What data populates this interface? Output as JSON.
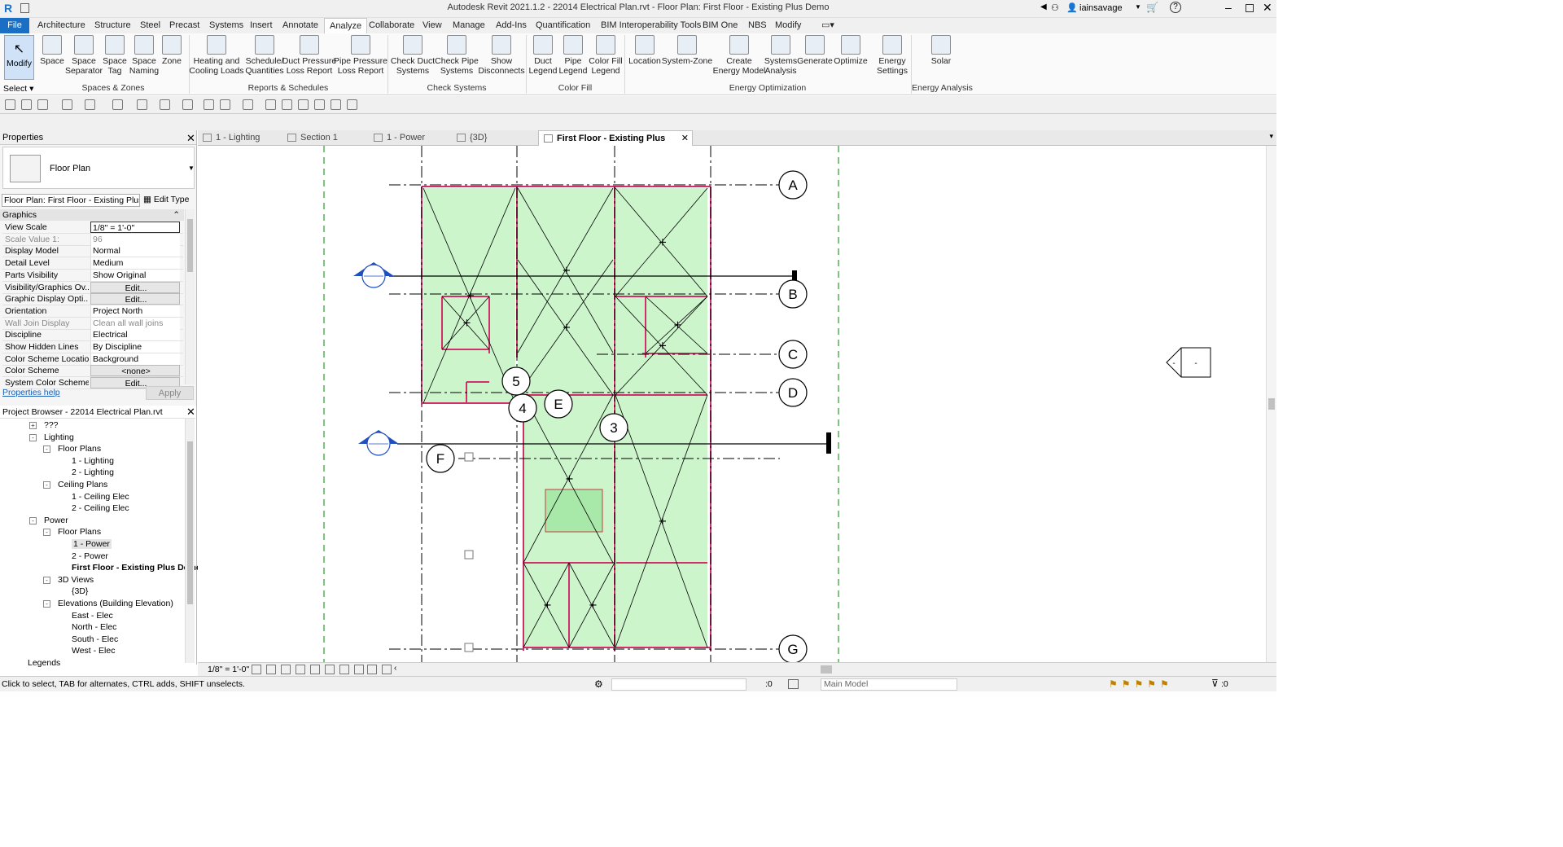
{
  "app": {
    "title": "Autodesk Revit 2021.1.2 - 22014 Electrical Plan.rvt - Floor Plan: First Floor - Existing Plus Demo",
    "user": "iainsavage",
    "help": "?"
  },
  "menu": {
    "tabs": [
      "File",
      "Architecture",
      "Structure",
      "Steel",
      "Precast",
      "Systems",
      "Insert",
      "Annotate",
      "Analyze",
      "Collaborate",
      "View",
      "Manage",
      "Add-Ins",
      "Quantification",
      "BIM Interoperability Tools",
      "BIM One",
      "NBS",
      "Modify"
    ],
    "active": "Analyze"
  },
  "ribbon": {
    "modify": "Modify",
    "select": "Select",
    "buttons": [
      {
        "l1": "Space",
        "l2": ""
      },
      {
        "l1": "Space",
        "l2": "Separator"
      },
      {
        "l1": "Space",
        "l2": "Tag"
      },
      {
        "l1": "Space",
        "l2": "Naming"
      },
      {
        "l1": "Zone",
        "l2": ""
      },
      {
        "l1": "Heating and",
        "l2": "Cooling Loads"
      },
      {
        "l1": "Schedule/",
        "l2": "Quantities"
      },
      {
        "l1": "Duct Pressure",
        "l2": "Loss Report"
      },
      {
        "l1": "Pipe Pressure",
        "l2": "Loss Report"
      },
      {
        "l1": "Check Duct",
        "l2": "Systems"
      },
      {
        "l1": "Check Pipe",
        "l2": "Systems"
      },
      {
        "l1": "Show",
        "l2": "Disconnects"
      },
      {
        "l1": "Duct",
        "l2": "Legend"
      },
      {
        "l1": "Pipe",
        "l2": "Legend"
      },
      {
        "l1": "Color Fill",
        "l2": "Legend"
      },
      {
        "l1": "Location",
        "l2": ""
      },
      {
        "l1": "System-Zone",
        "l2": ""
      },
      {
        "l1": "Create",
        "l2": "Energy Model"
      },
      {
        "l1": "Systems",
        "l2": "Analysis"
      },
      {
        "l1": "Generate",
        "l2": ""
      },
      {
        "l1": "Optimize",
        "l2": ""
      },
      {
        "l1": "Energy",
        "l2": "Settings"
      },
      {
        "l1": "Solar",
        "l2": ""
      }
    ],
    "groups": [
      "Spaces & Zones",
      "Reports & Schedules",
      "Check Systems",
      "Color Fill",
      "Energy Optimization",
      "Energy Analysis"
    ]
  },
  "properties": {
    "title": "Properties",
    "type_name": "Floor Plan",
    "instance": "Floor Plan: First Floor - Existing Plus",
    "edit_type": "Edit Type",
    "section": "Graphics",
    "rows": [
      {
        "k": "View Scale",
        "v": "1/8\" = 1'-0\""
      },
      {
        "k": "Scale Value    1:",
        "v": "96"
      },
      {
        "k": "Display Model",
        "v": "Normal"
      },
      {
        "k": "Detail Level",
        "v": "Medium"
      },
      {
        "k": "Parts Visibility",
        "v": "Show Original"
      },
      {
        "k": "Visibility/Graphics Ov...",
        "v": "Edit..."
      },
      {
        "k": "Graphic Display Opti...",
        "v": "Edit..."
      },
      {
        "k": "Orientation",
        "v": "Project North"
      },
      {
        "k": "Wall Join Display",
        "v": "Clean all wall joins"
      },
      {
        "k": "Discipline",
        "v": "Electrical"
      },
      {
        "k": "Show Hidden Lines",
        "v": "By Discipline"
      },
      {
        "k": "Color Scheme Location",
        "v": "Background"
      },
      {
        "k": "Color Scheme",
        "v": "<none>"
      },
      {
        "k": "System Color Schemes",
        "v": "Edit..."
      }
    ],
    "help": "Properties help",
    "apply": "Apply"
  },
  "browser": {
    "title": "Project Browser - 22014 Electrical Plan.rvt",
    "items": [
      {
        "t": "???",
        "lvl": 1,
        "g": "+"
      },
      {
        "t": "Lighting",
        "lvl": 1,
        "g": "-"
      },
      {
        "t": "Floor Plans",
        "lvl": 2,
        "g": "-"
      },
      {
        "t": "1 - Lighting",
        "lvl": 3,
        "g": ""
      },
      {
        "t": "2 - Lighting",
        "lvl": 3,
        "g": ""
      },
      {
        "t": "Ceiling Plans",
        "lvl": 2,
        "g": "-"
      },
      {
        "t": "1 - Ceiling Elec",
        "lvl": 3,
        "g": ""
      },
      {
        "t": "2 - Ceiling Elec",
        "lvl": 3,
        "g": ""
      },
      {
        "t": "Power",
        "lvl": 1,
        "g": "-"
      },
      {
        "t": "Floor Plans",
        "lvl": 2,
        "g": "-"
      },
      {
        "t": "1 - Power",
        "lvl": 3,
        "g": ""
      },
      {
        "t": "2 - Power",
        "lvl": 3,
        "g": ""
      },
      {
        "t": "First Floor - Existing Plus Demo",
        "lvl": 3,
        "g": ""
      },
      {
        "t": "3D Views",
        "lvl": 2,
        "g": "-"
      },
      {
        "t": "{3D}",
        "lvl": 3,
        "g": ""
      },
      {
        "t": "Elevations (Building Elevation)",
        "lvl": 2,
        "g": "-"
      },
      {
        "t": "East - Elec",
        "lvl": 3,
        "g": ""
      },
      {
        "t": "North - Elec",
        "lvl": 3,
        "g": ""
      },
      {
        "t": "South - Elec",
        "lvl": 3,
        "g": ""
      },
      {
        "t": "West - Elec",
        "lvl": 3,
        "g": ""
      },
      {
        "t": "Legends",
        "lvl": 0,
        "g": ""
      }
    ]
  },
  "view_tabs": [
    "1 - Lighting",
    "Section 1",
    "1 - Power",
    "{3D}",
    "First Floor - Existing Plus Demo"
  ],
  "grids": [
    "A",
    "B",
    "C",
    "D",
    "E",
    "F",
    "G",
    "3",
    "4",
    "5"
  ],
  "elevation_marker": "-",
  "view_scale": "1/8\" = 1'-0\"",
  "status": {
    "hint": "Click to select, TAB for alternates, CTRL adds, SHIFT unselects.",
    "count": ":0",
    "model": "Main Model",
    "filter_count": ":0"
  },
  "colors": {
    "accent": "#1a6fc4",
    "room_fill": "#ccf5cc",
    "wall": "#d0306a",
    "section": "#1f4fbf",
    "grid": "#000000",
    "ref_plane": "#2a9a2a"
  }
}
